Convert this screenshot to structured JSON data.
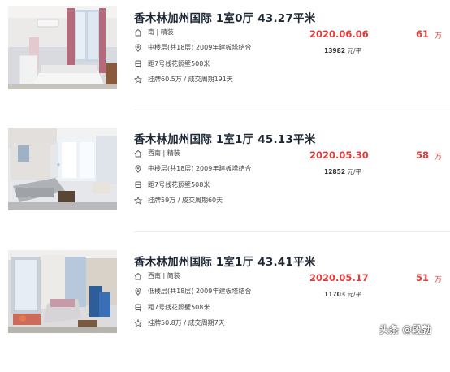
{
  "listings": [
    {
      "title": "香木林加州国际 1室0厅 43.27平米",
      "orientation": "南 | 精装",
      "floor": "中楼层(共18层) 2009年建板塔结合",
      "transit": "距7号线花照壁508米",
      "history": "挂牌60.5万 / 成交周期191天",
      "date": "2020.06.06",
      "unit_price": "13982",
      "unit_suffix": " 元/平",
      "total_price": "61",
      "total_unit": "万"
    },
    {
      "title": "香木林加州国际 1室1厅 45.13平米",
      "orientation": "西南 | 精装",
      "floor": "中楼层(共18层) 2009年建板塔结合",
      "transit": "距7号线花照壁508米",
      "history": "挂牌59万 / 成交周期60天",
      "date": "2020.05.30",
      "unit_price": "12852",
      "unit_suffix": " 元/平",
      "total_price": "58",
      "total_unit": "万"
    },
    {
      "title": "香木林加州国际 1室1厅 43.41平米",
      "orientation": "西南 | 简装",
      "floor": "低楼层(共18层) 2009年建板塔结合",
      "transit": "距7号线花照壁508米",
      "history": "挂牌50.8万 / 成交周期7天",
      "date": "2020.05.17",
      "unit_price": "11703",
      "unit_suffix": " 元/平",
      "total_price": "51",
      "total_unit": "万"
    }
  ],
  "watermark": "头条 @段勃",
  "colors": {
    "accent": "#e23b3b",
    "title": "#1d2733",
    "text": "#444444"
  },
  "icons": [
    "home-icon",
    "location-pin-icon",
    "metro-icon",
    "star-icon"
  ]
}
